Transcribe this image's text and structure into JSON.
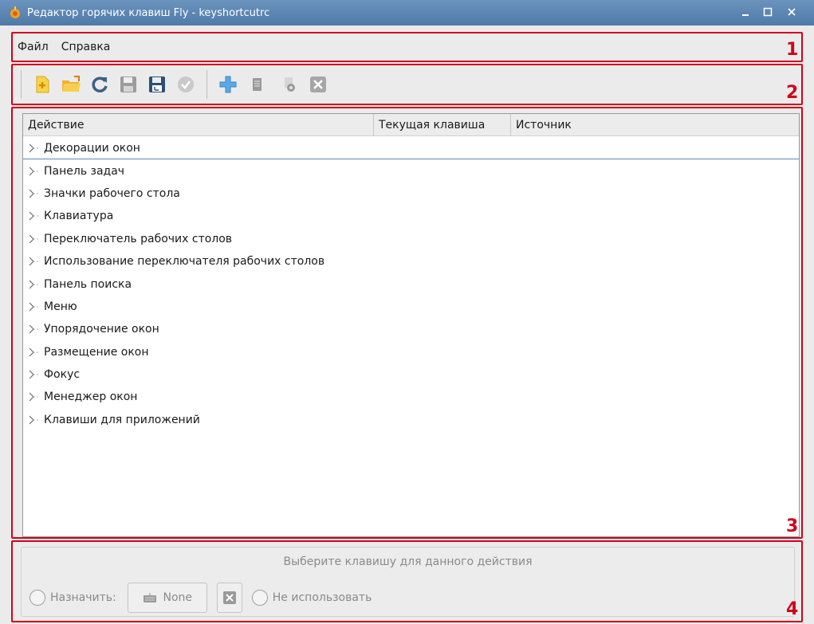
{
  "window": {
    "title": "Редактор горячих клавиш Fly - keyshortcutrc",
    "controls": [
      "minimize-icon",
      "maximize-icon",
      "close-icon"
    ]
  },
  "menubar": {
    "items": [
      {
        "label": "Файл"
      },
      {
        "label": "Справка"
      }
    ]
  },
  "toolbar": {
    "buttons": [
      "new-file-icon",
      "open-folder-icon",
      "reload-icon",
      "save-icon",
      "save-as-icon",
      "apply-check-icon",
      "add-icon",
      "clipboard-icon",
      "settings-icon",
      "delete-icon"
    ]
  },
  "tree": {
    "columns": [
      "Действие",
      "Текущая клавиша",
      "Источник"
    ],
    "rows": [
      {
        "label": "Декорации окон"
      },
      {
        "label": "Панель задач"
      },
      {
        "label": "Значки рабочего стола"
      },
      {
        "label": "Клавиатура"
      },
      {
        "label": "Переключатель рабочих столов"
      },
      {
        "label": "Использование переключателя рабочих столов"
      },
      {
        "label": "Панель поиска"
      },
      {
        "label": "Меню"
      },
      {
        "label": "Упорядочение окон"
      },
      {
        "label": "Размещение окон"
      },
      {
        "label": "Фокус"
      },
      {
        "label": "Менеджер окон"
      },
      {
        "label": "Клавиши для приложений"
      }
    ]
  },
  "key_panel": {
    "hint": "Выберите клавишу для данного действия",
    "assign_label": "Назначить:",
    "key_value": "None",
    "no_use_label": "Не использовать"
  },
  "markers": [
    "1",
    "2",
    "3",
    "4"
  ],
  "colors": {
    "titlebar": "#5a84b2",
    "annotation": "#d0021b",
    "selection_line": "#5b86b6"
  }
}
